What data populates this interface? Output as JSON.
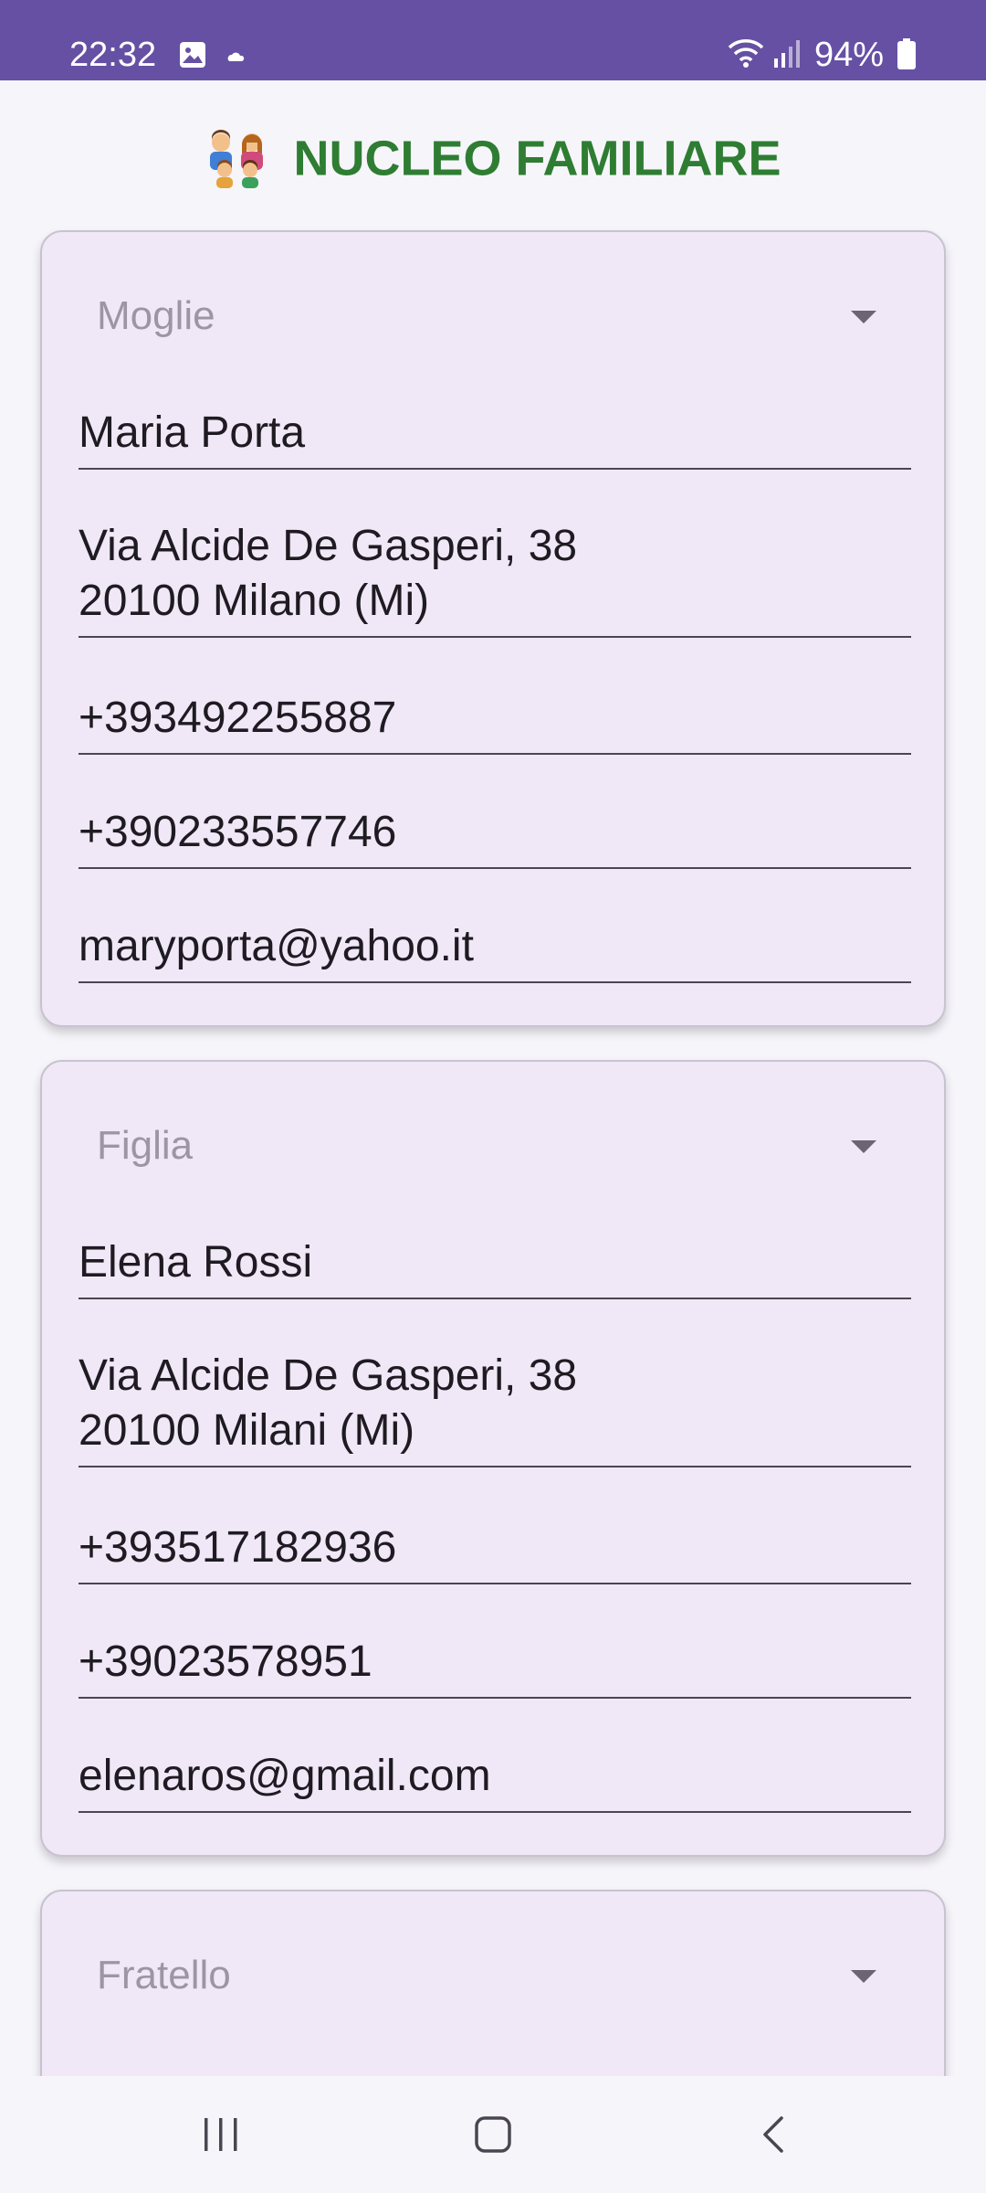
{
  "status_bar": {
    "time": "22:32",
    "battery": "94%",
    "icons": [
      "image-icon",
      "cloud-icon",
      "wifi-icon",
      "signal-icon",
      "battery-icon"
    ],
    "background": "#6650a4"
  },
  "header": {
    "title": "NUCLEO FAMILIARE",
    "icon": "family-emoji-icon",
    "color": "#2e7d32"
  },
  "cards": [
    {
      "relation": "Moglie",
      "name": "Maria Porta",
      "address": "Via Alcide De Gasperi, 38\n20100 Milano  (Mi)",
      "mobile": "+393492255887",
      "phone": "+390233557746",
      "email": "maryporta@yahoo.it"
    },
    {
      "relation": "Figlia",
      "name": "Elena Rossi",
      "address": "Via Alcide De Gasperi, 38\n20100 Milani (Mi)",
      "mobile": "+393517182936",
      "phone": "+39023578951",
      "email": "elenaros@gmail.com"
    },
    {
      "relation": "Fratello"
    }
  ],
  "nav_bar": {
    "icons": [
      "recents-icon",
      "home-icon",
      "back-icon"
    ]
  }
}
